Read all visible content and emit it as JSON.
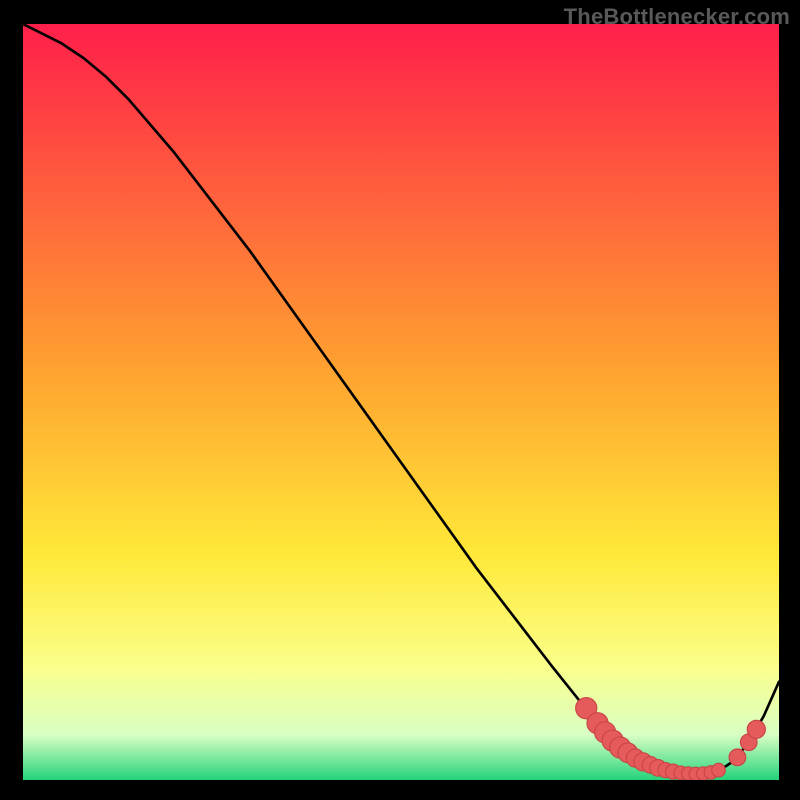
{
  "watermark": "TheBottlenecker.com",
  "colors": {
    "bg": "#000000",
    "gradient_top": "#ff1f4a",
    "gradient_upper_mid": "#ffa030",
    "gradient_mid": "#ffe838",
    "gradient_lower": "#faff8a",
    "gradient_pale": "#d9ffc4",
    "gradient_bottom": "#24d37a",
    "curve": "#000000",
    "marker": "#e55a5a",
    "marker_stroke": "#c94545"
  },
  "chart_data": {
    "type": "line",
    "title": "",
    "xlabel": "",
    "ylabel": "",
    "xlim": [
      0,
      100
    ],
    "ylim": [
      0,
      100
    ],
    "grid": false,
    "legend": false,
    "series": [
      {
        "name": "bottleneck-curve",
        "x": [
          0,
          2,
          5,
          8,
          11,
          14,
          17,
          20,
          25,
          30,
          35,
          40,
          45,
          50,
          55,
          60,
          65,
          70,
          74,
          77,
          80,
          82,
          84,
          86,
          88,
          90,
          92,
          94,
          96,
          98,
          100
        ],
        "y": [
          100,
          99,
          97.5,
          95.5,
          93,
          90,
          86.5,
          83,
          76.5,
          70,
          63,
          56,
          49,
          42,
          35,
          28,
          21.5,
          15,
          10,
          6.5,
          4,
          2.6,
          1.8,
          1.2,
          0.8,
          0.8,
          1.2,
          2.5,
          5,
          8.5,
          13
        ]
      }
    ],
    "markers": [
      {
        "x": 74.5,
        "y": 9.5,
        "r": 1.4
      },
      {
        "x": 76,
        "y": 7.5,
        "r": 1.4
      },
      {
        "x": 77,
        "y": 6.3,
        "r": 1.4
      },
      {
        "x": 78,
        "y": 5.2,
        "r": 1.4
      },
      {
        "x": 79,
        "y": 4.3,
        "r": 1.4
      },
      {
        "x": 80,
        "y": 3.6,
        "r": 1.3
      },
      {
        "x": 81,
        "y": 2.9,
        "r": 1.2
      },
      {
        "x": 82,
        "y": 2.4,
        "r": 1.2
      },
      {
        "x": 83,
        "y": 2.0,
        "r": 1.1
      },
      {
        "x": 84,
        "y": 1.6,
        "r": 1.1
      },
      {
        "x": 85,
        "y": 1.3,
        "r": 1.0
      },
      {
        "x": 86,
        "y": 1.1,
        "r": 1.0
      },
      {
        "x": 87,
        "y": 0.95,
        "r": 0.9
      },
      {
        "x": 88,
        "y": 0.85,
        "r": 0.9
      },
      {
        "x": 89,
        "y": 0.8,
        "r": 0.9
      },
      {
        "x": 90,
        "y": 0.85,
        "r": 0.9
      },
      {
        "x": 91,
        "y": 1.0,
        "r": 0.9
      },
      {
        "x": 92,
        "y": 1.3,
        "r": 0.9
      },
      {
        "x": 94.5,
        "y": 3.0,
        "r": 1.1
      },
      {
        "x": 96,
        "y": 5.0,
        "r": 1.1
      },
      {
        "x": 97,
        "y": 6.7,
        "r": 1.2
      }
    ],
    "gradient_stops": [
      {
        "offset": 0,
        "color_key": "gradient_top"
      },
      {
        "offset": 45,
        "color_key": "gradient_upper_mid"
      },
      {
        "offset": 70,
        "color_key": "gradient_mid"
      },
      {
        "offset": 85,
        "color_key": "gradient_lower"
      },
      {
        "offset": 94,
        "color_key": "gradient_pale"
      },
      {
        "offset": 100,
        "color_key": "gradient_bottom"
      }
    ]
  }
}
